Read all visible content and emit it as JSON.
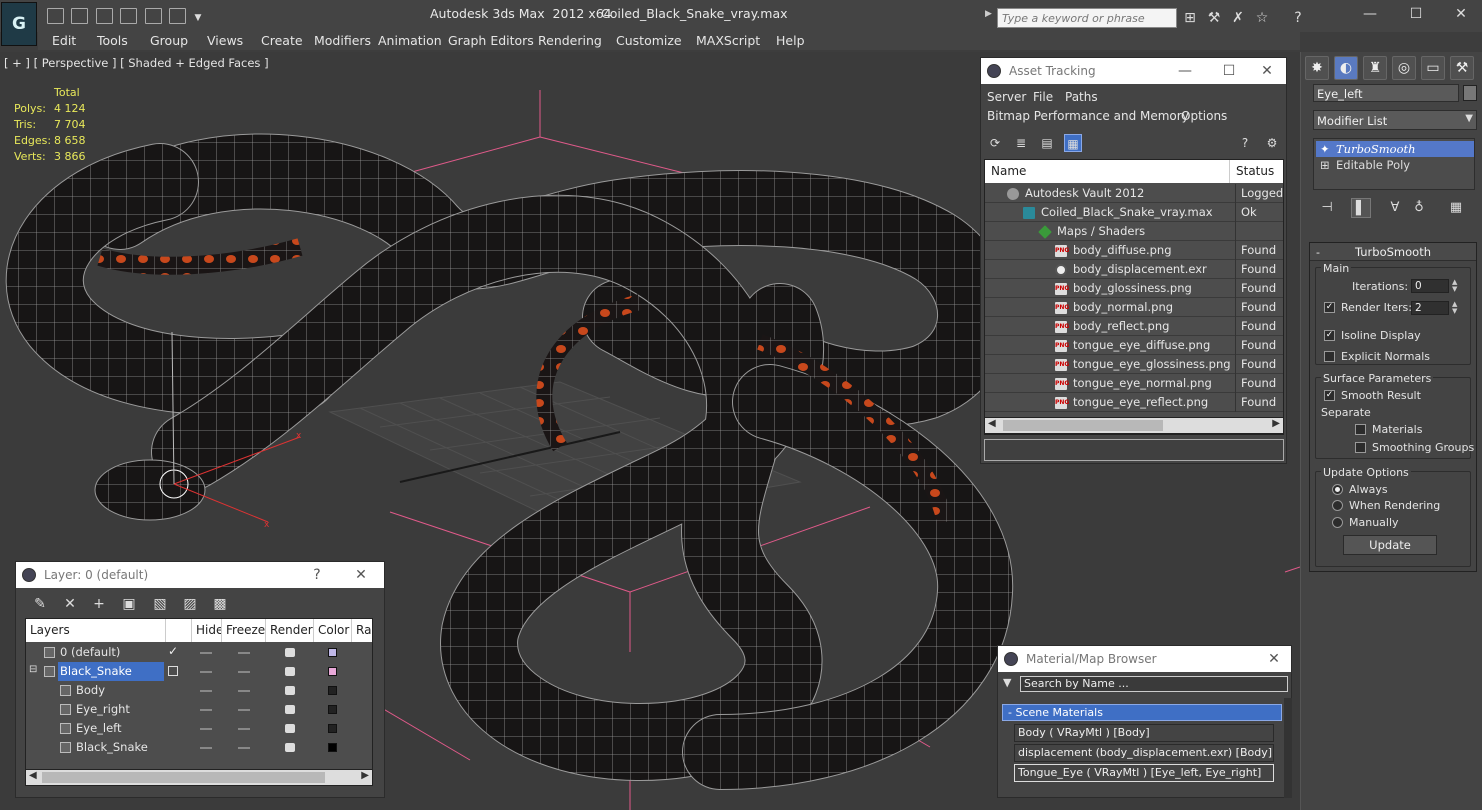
{
  "titlebar": {
    "app_title": "Autodesk 3ds Max  2012 x64",
    "file_title": "Coiled_Black_Snake_vray.max",
    "search_placeholder": "Type a keyword or phrase"
  },
  "menu": [
    "Edit",
    "Tools",
    "Group",
    "Views",
    "Create",
    "Modifiers",
    "Animation",
    "Graph Editors",
    "Rendering",
    "Customize",
    "MAXScript",
    "Help"
  ],
  "viewport": {
    "label": "[ + ] [ Perspective ] [ Shaded + Edged Faces ]",
    "stats_header": "Total",
    "stats": [
      {
        "k": "Polys:",
        "v": "4 124"
      },
      {
        "k": "Tris:",
        "v": "7 704"
      },
      {
        "k": "Edges:",
        "v": "8 658"
      },
      {
        "k": "Verts:",
        "v": "3 866"
      }
    ]
  },
  "asset_tracking": {
    "title": "Asset Tracking",
    "menu1": [
      "Server",
      "File",
      "Paths"
    ],
    "menu2": [
      "Bitmap Performance and Memory",
      "Options"
    ],
    "col_name": "Name",
    "col_status": "Status",
    "rows": [
      {
        "name": "Autodesk Vault 2012",
        "status": "Logged O",
        "indent": 0,
        "icon": "vault"
      },
      {
        "name": "Coiled_Black_Snake_vray.max",
        "status": "Ok",
        "indent": 1,
        "icon": "max"
      },
      {
        "name": "Maps / Shaders",
        "status": "",
        "indent": 2,
        "icon": "maps"
      },
      {
        "name": "body_diffuse.png",
        "status": "Found",
        "indent": 3,
        "icon": "png"
      },
      {
        "name": "body_displacement.exr",
        "status": "Found",
        "indent": 3,
        "icon": "exr"
      },
      {
        "name": "body_glossiness.png",
        "status": "Found",
        "indent": 3,
        "icon": "png"
      },
      {
        "name": "body_normal.png",
        "status": "Found",
        "indent": 3,
        "icon": "png"
      },
      {
        "name": "body_reflect.png",
        "status": "Found",
        "indent": 3,
        "icon": "png"
      },
      {
        "name": "tongue_eye_diffuse.png",
        "status": "Found",
        "indent": 3,
        "icon": "png"
      },
      {
        "name": "tongue_eye_glossiness.png",
        "status": "Found",
        "indent": 3,
        "icon": "png"
      },
      {
        "name": "tongue_eye_normal.png",
        "status": "Found",
        "indent": 3,
        "icon": "png"
      },
      {
        "name": "tongue_eye_reflect.png",
        "status": "Found",
        "indent": 3,
        "icon": "png"
      }
    ]
  },
  "layer_window": {
    "title": "Layer: 0 (default)",
    "help": "?",
    "columns": [
      "Layers",
      "Hide",
      "Freeze",
      "Render",
      "Color",
      "Rad"
    ],
    "rows": [
      {
        "name": "0 (default)",
        "active": true,
        "color": "#c0b8e8",
        "level": 0,
        "selected": false
      },
      {
        "name": "Black_Snake",
        "active": false,
        "color": "#e8a8d8",
        "level": 0,
        "selected": true
      },
      {
        "name": "Body",
        "active": false,
        "color": "#222222",
        "level": 1,
        "selected": false
      },
      {
        "name": "Eye_right",
        "active": false,
        "color": "#222222",
        "level": 1,
        "selected": false
      },
      {
        "name": "Eye_left",
        "active": false,
        "color": "#222222",
        "level": 1,
        "selected": false
      },
      {
        "name": "Black_Snake",
        "active": false,
        "color": "#000000",
        "level": 1,
        "selected": false
      }
    ]
  },
  "material_browser": {
    "title": "Material/Map Browser",
    "search_placeholder": "Search by Name ...",
    "section": "Scene Materials",
    "items": [
      "Body  ( VRayMtl )  [Body]",
      "displacement (body_displacement.exr) [Body]",
      "Tongue_Eye  ( VRayMtl )  [Eye_left, Eye_right]"
    ]
  },
  "command_panel": {
    "object_name": "Eye_left",
    "modifier_list": "Modifier List",
    "stack": [
      "TurboSmooth",
      "Editable Poly"
    ],
    "rollout_title": "TurboSmooth",
    "main_label": "Main",
    "iterations_label": "Iterations:",
    "iterations_value": "0",
    "render_iters_label": "Render Iters:",
    "render_iters_value": "2",
    "isoline_label": "Isoline Display",
    "explicit_label": "Explicit Normals",
    "surface_label": "Surface Parameters",
    "smooth_label": "Smooth Result",
    "separate_label": "Separate",
    "materials_label": "Materials",
    "smoothing_groups_label": "Smoothing Groups",
    "update_options_label": "Update Options",
    "always_label": "Always",
    "when_rendering_label": "When Rendering",
    "manually_label": "Manually",
    "update_button": "Update"
  },
  "colors": {
    "selection_blue": "#3f6fc5",
    "stats_yellow": "#e8e85a",
    "snake_scale_orange": "#c8481c"
  }
}
